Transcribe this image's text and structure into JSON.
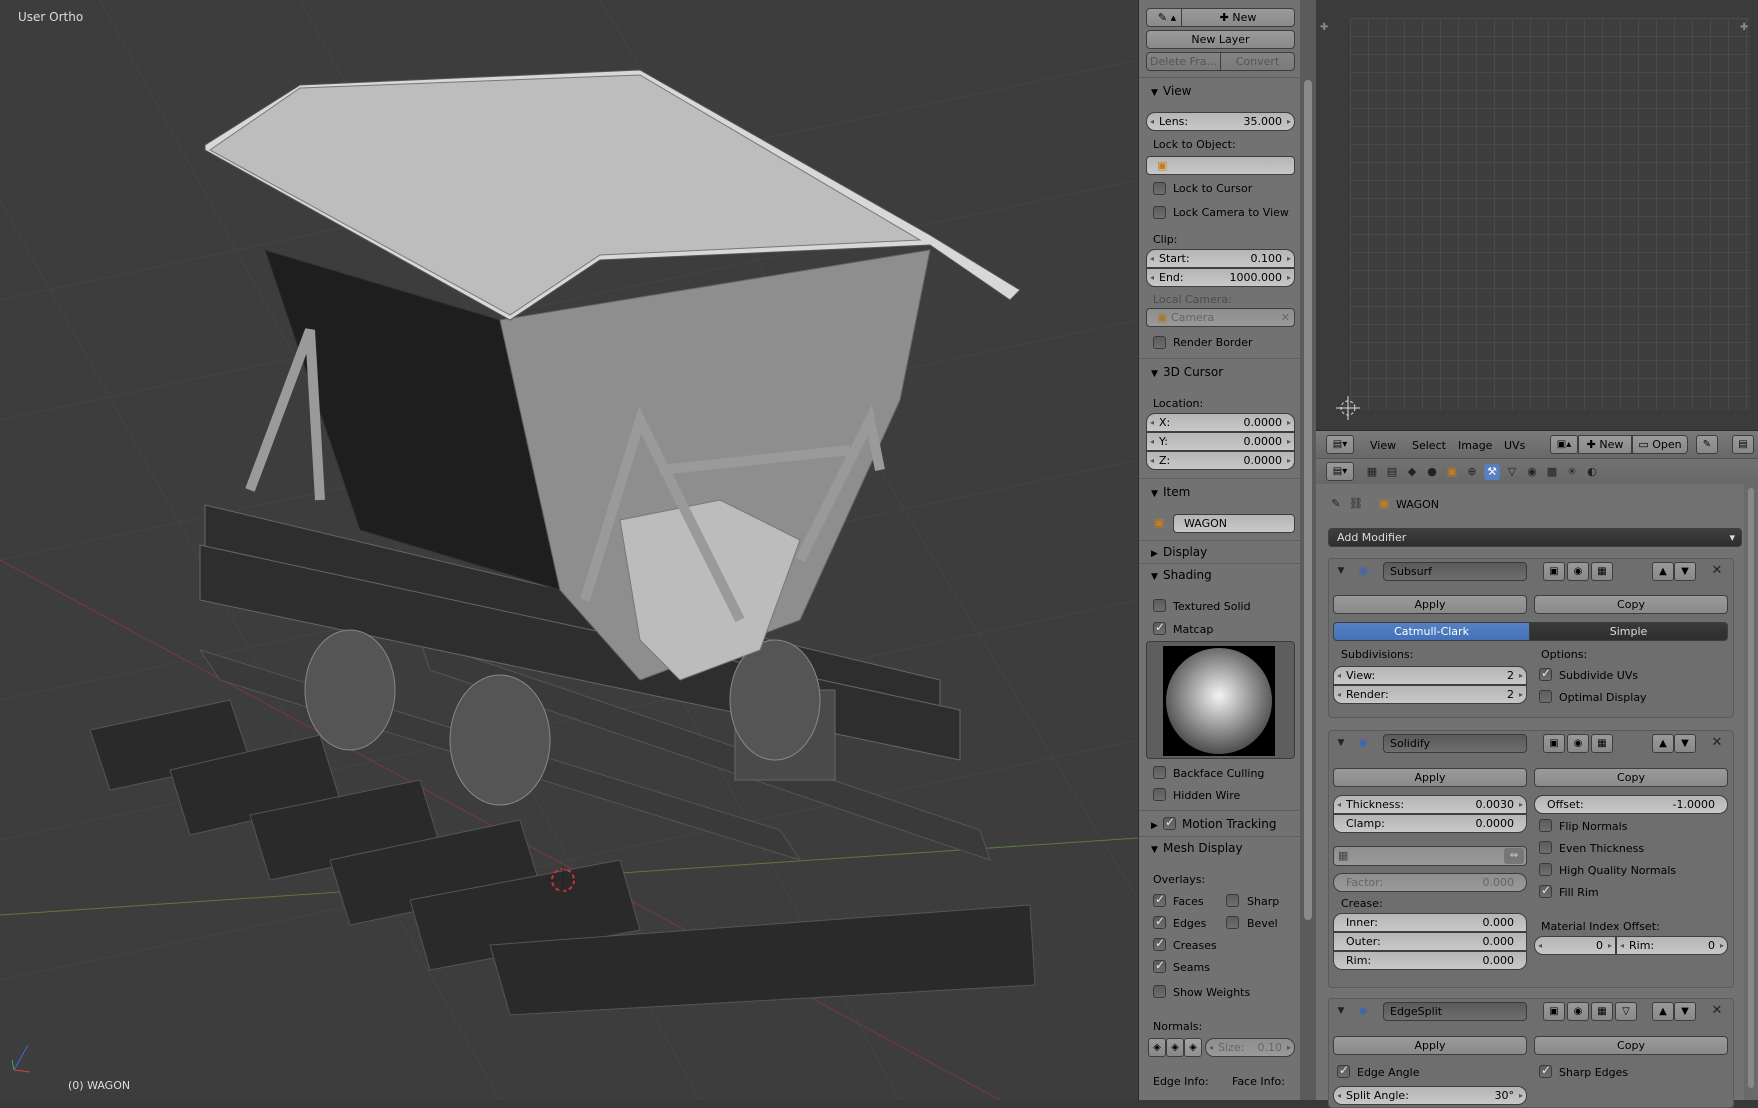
{
  "viewport": {
    "view_name": "User Ortho",
    "object_label": "(0) WAGON"
  },
  "grease_pencil": {
    "new_label": "New",
    "new_layer_label": "New Layer",
    "delete_frame_label": "Delete Fra...",
    "convert_label": "Convert"
  },
  "view_panel": {
    "title": "View",
    "lens_label": "Lens:",
    "lens_value": "35.000",
    "lock_to_object_label": "Lock to Object:",
    "lock_to_cursor_label": "Lock to Cursor",
    "lock_camera_label": "Lock Camera to View",
    "clip_label": "Clip:",
    "start_label": "Start:",
    "start_value": "0.100",
    "end_label": "End:",
    "end_value": "1000.000",
    "local_camera_label": "Local Camera:",
    "camera_value": "Camera",
    "render_border_label": "Render Border"
  },
  "cursor_panel": {
    "title": "3D Cursor",
    "location_label": "Location:",
    "x_label": "X:",
    "x_value": "0.0000",
    "y_label": "Y:",
    "y_value": "0.0000",
    "z_label": "Z:",
    "z_value": "0.0000"
  },
  "item_panel": {
    "title": "Item",
    "name": "WAGON"
  },
  "display_panel": {
    "title": "Display"
  },
  "shading_panel": {
    "title": "Shading",
    "textured_solid_label": "Textured Solid",
    "matcap_label": "Matcap",
    "backface_label": "Backface Culling",
    "hidden_wire_label": "Hidden Wire"
  },
  "motion_tracking_panel": {
    "title": "Motion Tracking"
  },
  "mesh_display_panel": {
    "title": "Mesh Display",
    "overlays_label": "Overlays:",
    "faces_label": "Faces",
    "sharp_label": "Sharp",
    "edges_label": "Edges",
    "bevel_label": "Bevel",
    "creases_label": "Creases",
    "seams_label": "Seams",
    "show_weights_label": "Show Weights",
    "normals_label": "Normals:",
    "size_label": "Size:",
    "size_value": "0.10",
    "edge_info_label": "Edge Info:",
    "face_info_label": "Face Info:"
  },
  "uv_header": {
    "view": "View",
    "select": "Select",
    "image": "Image",
    "uvs": "UVs",
    "new": "New",
    "open": "Open"
  },
  "properties": {
    "object_name": "WAGON",
    "add_modifier": "Add Modifier"
  },
  "subsurf": {
    "name": "Subsurf",
    "apply": "Apply",
    "copy": "Copy",
    "catmull": "Catmull-Clark",
    "simple": "Simple",
    "subdivisions_label": "Subdivisions:",
    "options_label": "Options:",
    "view_label": "View:",
    "view_value": "2",
    "render_label": "Render:",
    "render_value": "2",
    "subdivide_uvs": "Subdivide UVs",
    "optimal_display": "Optimal Display"
  },
  "solidify": {
    "name": "Solidify",
    "apply": "Apply",
    "copy": "Copy",
    "thickness_label": "Thickness:",
    "thickness_value": "0.0030",
    "offset_label": "Offset:",
    "offset_value": "-1.0000",
    "clamp_label": "Clamp:",
    "clamp_value": "0.0000",
    "flip_normals": "Flip Normals",
    "even_thickness": "Even Thickness",
    "high_quality": "High Quality Normals",
    "fill_rim": "Fill Rim",
    "factor_label": "Factor:",
    "factor_value": "0.000",
    "crease_label": "Crease:",
    "inner_label": "Inner:",
    "inner_value": "0.000",
    "outer_label": "Outer:",
    "outer_value": "0.000",
    "rim_label": "Rim:",
    "rim_value": "0.000",
    "mat_offset_label": "Material Index Offset:",
    "mat_offset_value": "0",
    "mat_rim_label": "Rim:",
    "mat_rim_value": "0"
  },
  "edgesplit": {
    "name": "EdgeSplit",
    "apply": "Apply",
    "copy": "Copy",
    "edge_angle": "Edge Angle",
    "sharp_edges": "Sharp Edges",
    "split_angle_label": "Split Angle:",
    "split_angle_value": "30°"
  },
  "colors": {
    "selection_blue": "#5680c2",
    "panel_bg": "#727272",
    "viewport_bg": "#3d3d3d"
  }
}
